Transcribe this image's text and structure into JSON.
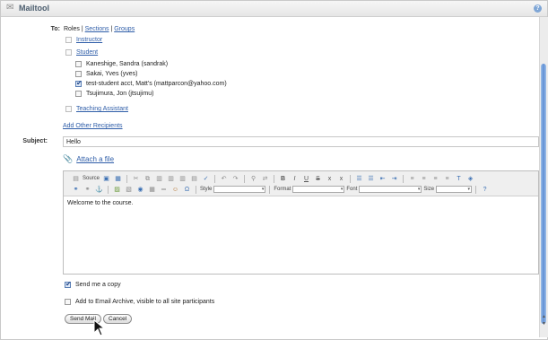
{
  "window": {
    "title": "Mailtool"
  },
  "to": {
    "label": "To:",
    "tabs": {
      "roles": "Roles",
      "sep1": "|",
      "sections": "Sections",
      "sep2": "|",
      "groups": "Groups"
    },
    "roles": [
      {
        "label": "Instructor",
        "checked": false
      },
      {
        "label": "Student",
        "checked": false,
        "members": [
          {
            "label": "Kaneshige, Sandra (sandrak)",
            "checked": false
          },
          {
            "label": "Sakai, Yves (yves)",
            "checked": false
          },
          {
            "label": "test-student acct, Matt's (mattparcon@yahoo.com)",
            "checked": true
          },
          {
            "label": "Tsujimura, Jon (jtsujimu)",
            "checked": false
          }
        ]
      },
      {
        "label": "Teaching Assistant",
        "checked": false
      }
    ],
    "add_other": "Add Other Recipients"
  },
  "subject": {
    "label": "Subject:",
    "value": "Hello"
  },
  "attach": {
    "label": "Attach a file"
  },
  "editor": {
    "source_label": "Source",
    "style_label": "Style",
    "format_label": "Format",
    "font_label": "Font",
    "size_label": "Size",
    "body": "Welcome to the course."
  },
  "options": {
    "send_copy": {
      "label": "Send me a copy",
      "checked": true
    },
    "archive": {
      "label": "Add to Email Archive, visible to all site participants",
      "checked": false
    }
  },
  "buttons": {
    "send": "Send Mail",
    "cancel": "Cancel"
  },
  "colors": {
    "link": "#2e5da8",
    "accent": "#5f8fd4"
  }
}
